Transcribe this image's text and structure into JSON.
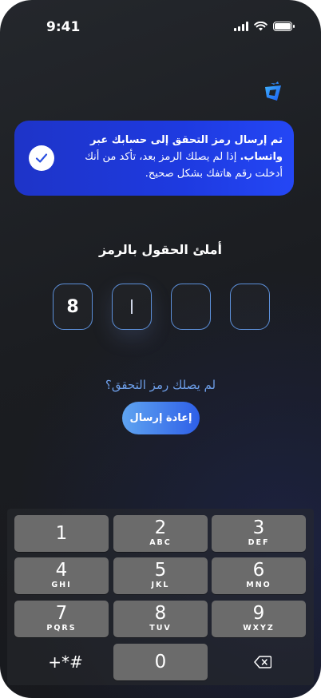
{
  "status_bar": {
    "time": "9:41"
  },
  "toast": {
    "title": "تم إرسال رمز التحقق إلى حسابك عبر واتساب.",
    "body": "إذا لم يصلك الرمز بعد، تأكد من أنك أدخلت رقم هاتفك بشكل صحيح.",
    "icon": "check-icon",
    "accent": "#1e3ae0"
  },
  "heading": "أملئ الحقول بالرمز",
  "otp": {
    "digits": [
      "8",
      "",
      "",
      ""
    ]
  },
  "resend": {
    "prompt": "لم يصلك رمز التحقق؟",
    "button": "إعادة إرسال"
  },
  "keypad": {
    "keys": [
      {
        "num": "1",
        "letters": ""
      },
      {
        "num": "2",
        "letters": "ABC"
      },
      {
        "num": "3",
        "letters": "DEF"
      },
      {
        "num": "4",
        "letters": "GHI"
      },
      {
        "num": "5",
        "letters": "JKL"
      },
      {
        "num": "6",
        "letters": "MNO"
      },
      {
        "num": "7",
        "letters": "PQRS"
      },
      {
        "num": "8",
        "letters": "TUV"
      },
      {
        "num": "9",
        "letters": "WXYZ"
      },
      {
        "num": "0",
        "letters": ""
      }
    ],
    "symbols": "+*#",
    "backspace_icon": "backspace-icon"
  }
}
